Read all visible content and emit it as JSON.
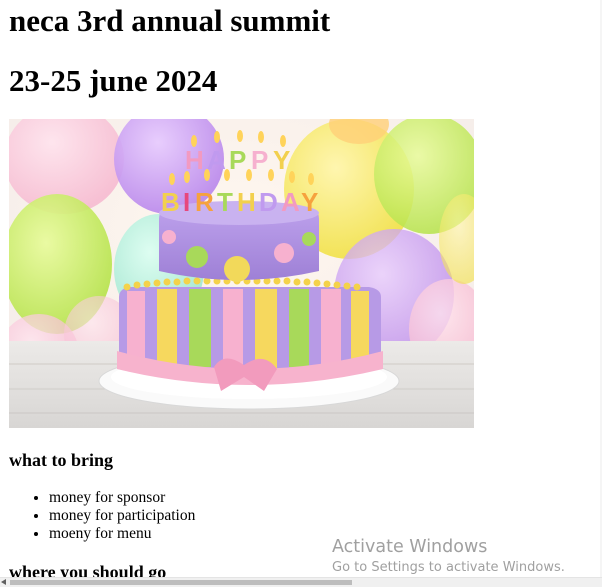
{
  "header": {
    "title": "neca 3rd annual summit",
    "date": "23-25 june 2024"
  },
  "hero_image": {
    "icon": "birthday-cake-image",
    "letters_top": [
      "H",
      "A",
      "P",
      "P",
      "Y"
    ],
    "letters_bottom": [
      "B",
      "I",
      "R",
      "T",
      "H",
      "D",
      "A",
      "Y"
    ]
  },
  "sections": {
    "bring_heading": "what to bring",
    "bring_items": [
      "money for sponsor",
      "money for participation",
      "moeny for menu"
    ],
    "where_heading": "where you should go"
  },
  "watermark": {
    "title": "Activate Windows",
    "subtitle": "Go to Settings to activate Windows."
  }
}
